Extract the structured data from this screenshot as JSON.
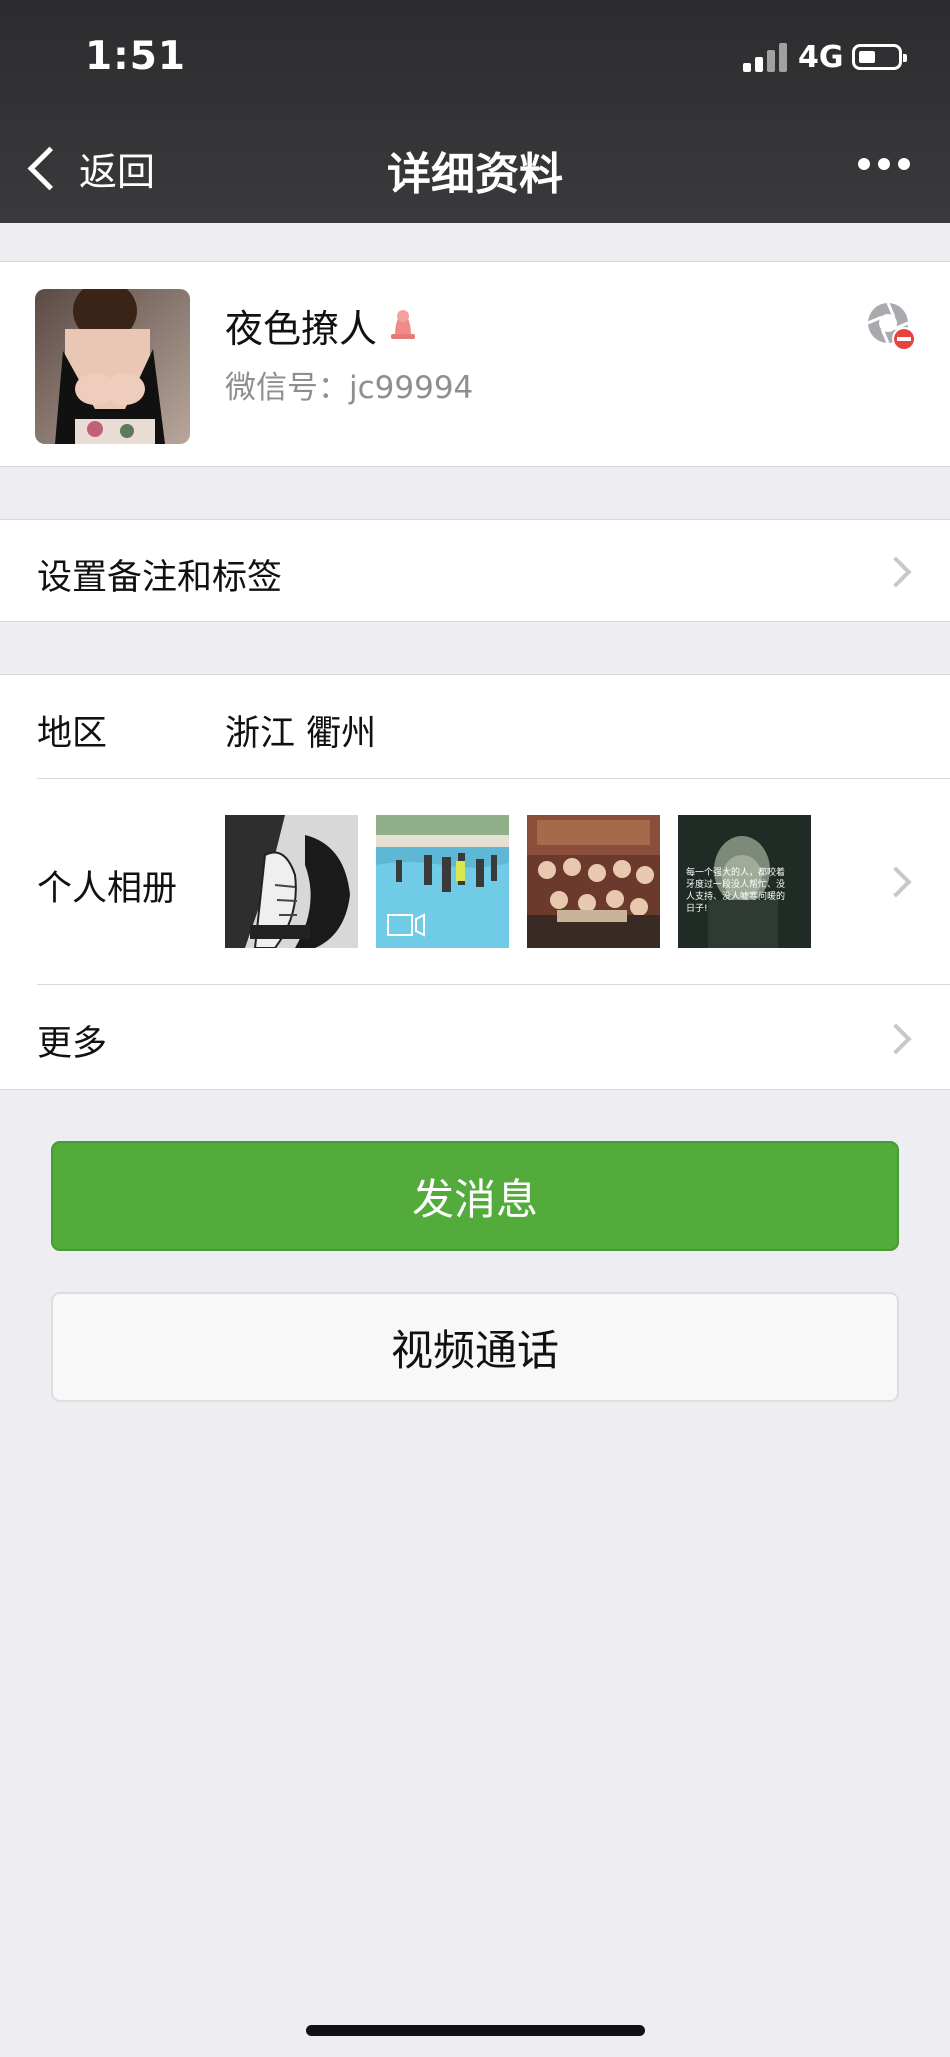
{
  "status_bar": {
    "time": "1:51",
    "network": "4G"
  },
  "nav": {
    "back_label": "返回",
    "title": "详细资料"
  },
  "profile": {
    "name": "夜色撩人",
    "wechat_id": "微信号：jc99994"
  },
  "rows": {
    "remark": "设置备注和标签",
    "region_label": "地区",
    "region_value": "浙江 衢州",
    "album_label": "个人相册",
    "more": "更多"
  },
  "album_thumbnails": [
    {
      "icon": "bw-illustration"
    },
    {
      "icon": "pool-video",
      "video_icon": "video-icon"
    },
    {
      "icon": "crowd-photo"
    },
    {
      "icon": "quote-poster",
      "caption": "每一个强大的人，都咬着牙度过一段没人帮忙、没人支持、没人嘘寒问暖的日子!"
    }
  ],
  "buttons": {
    "send_message": "发消息",
    "video_call": "视频通话"
  },
  "colors": {
    "accent_green": "#52ab3b",
    "nav_bg": "#333335",
    "page_bg": "#ededf2"
  }
}
